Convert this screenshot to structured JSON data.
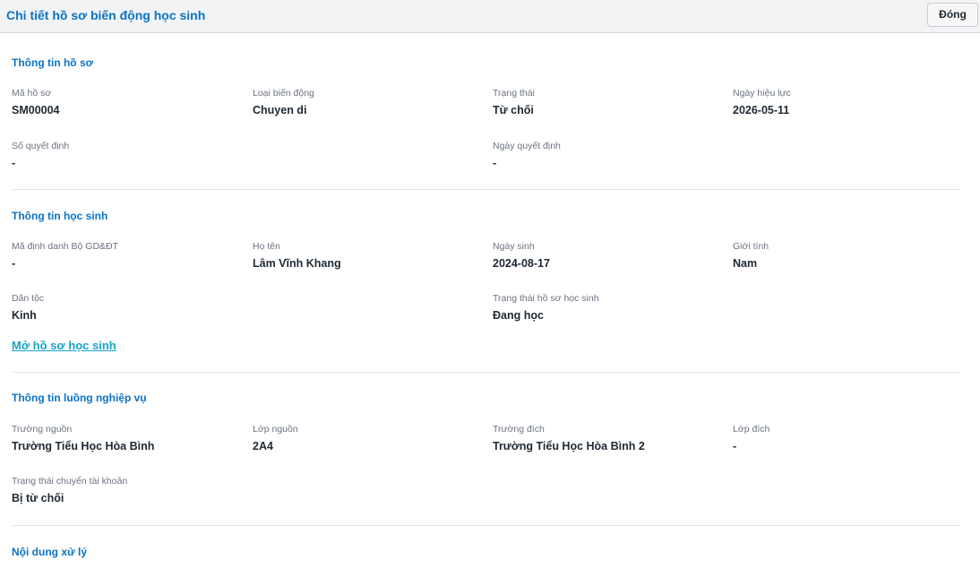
{
  "header": {
    "title": "Chi tiết hồ sơ biến động học sinh",
    "close_label": "Đóng"
  },
  "profile": {
    "title": "Thông tin hồ sơ",
    "fields": [
      {
        "label": "Mã hồ sơ",
        "value": "SM00004"
      },
      {
        "label": "Loại biến động",
        "value": "Chuyen di"
      },
      {
        "label": "Trạng thái",
        "value": "Từ chối"
      },
      {
        "label": "Ngày hiệu lực",
        "value": "2026-05-11"
      },
      {
        "label": "Số quyết định",
        "value": "-"
      },
      {
        "label": "Ngày quyết định",
        "value": "-"
      }
    ]
  },
  "student": {
    "title": "Thông tin học sinh",
    "fields": [
      {
        "label": "Mã định danh Bộ GD&ĐT",
        "value": "-"
      },
      {
        "label": "Họ tên",
        "value": "Lâm Vĩnh Khang"
      },
      {
        "label": "Ngày sinh",
        "value": "2024-08-17"
      },
      {
        "label": "Giới tính",
        "value": "Nam"
      },
      {
        "label": "Dân tộc",
        "value": "Kinh"
      },
      {
        "label": "Trạng thái hồ sơ học sinh",
        "value": "Đang học"
      }
    ],
    "open_link": "Mở hồ sơ học sinh"
  },
  "workflow": {
    "title": "Thông tin luồng nghiệp vụ",
    "fields": [
      {
        "label": "Trường nguồn",
        "value": "Trường Tiểu Học Hòa Bình"
      },
      {
        "label": "Lớp nguồn",
        "value": "2A4"
      },
      {
        "label": "Trường đích",
        "value": "Trường Tiểu Học Hòa Bình 2"
      },
      {
        "label": "Lớp đích",
        "value": "-"
      },
      {
        "label": "Trạng thái chuyển tài khoản",
        "value": "Bị từ chối"
      }
    ]
  },
  "processing": {
    "title": "Nội dung xử lý"
  }
}
